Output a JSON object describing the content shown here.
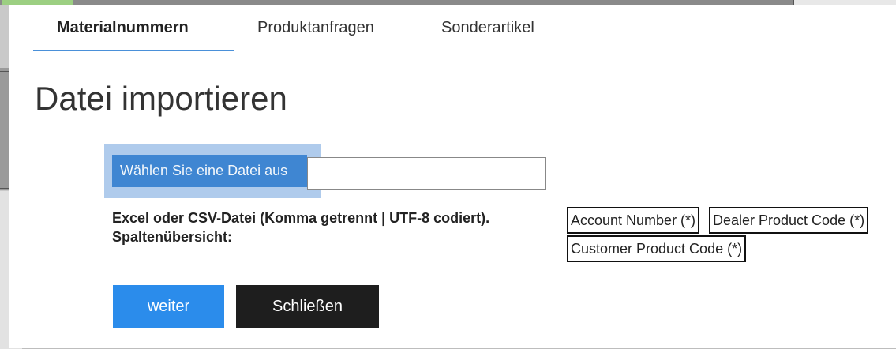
{
  "tabs": [
    {
      "label": "Materialnummern",
      "active": true
    },
    {
      "label": "Produktanfragen",
      "active": false
    },
    {
      "label": "Sonderartikel",
      "active": false
    }
  ],
  "dialog_title": "Datei importieren",
  "file_picker": {
    "button_label": "Wählen Sie eine Datei aus",
    "value": ""
  },
  "info": {
    "format_text": "Excel oder CSV-Datei (Komma getrennt | UTF-8 codiert).",
    "columns_label": "Spaltenübersicht:"
  },
  "columns": [
    "Account Number (*)",
    "Dealer Product Code (*)",
    "Customer Product Code (*)"
  ],
  "buttons": {
    "next": "weiter",
    "close": "Schließen"
  },
  "colors": {
    "accent": "#2b8ceb",
    "close_button": "#1e1e1e",
    "tab_underline": "#4a90d9"
  }
}
